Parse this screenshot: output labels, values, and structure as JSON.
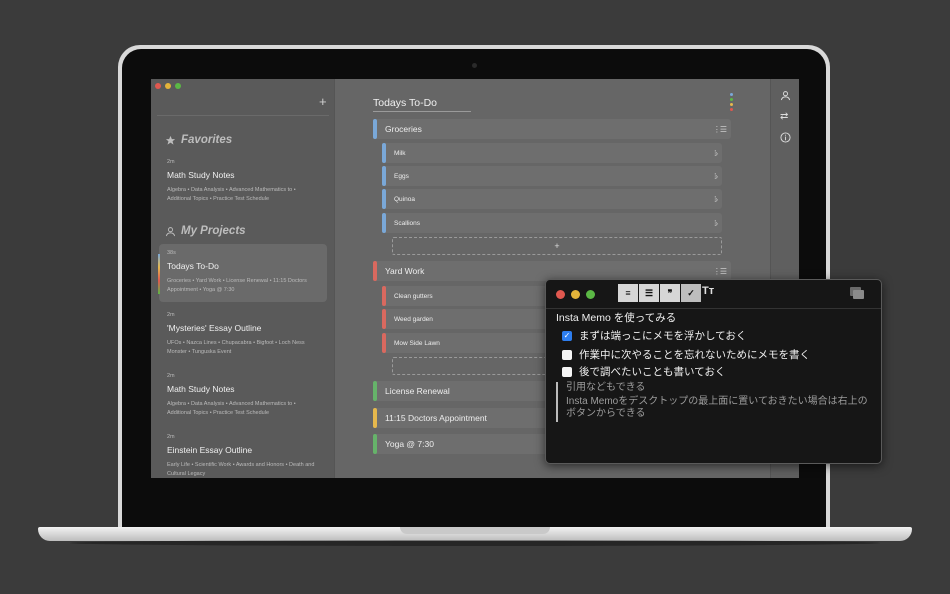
{
  "colors": {
    "red": "#e0584f",
    "yellow": "#e3b33a",
    "green": "#5bb845",
    "blue": "#2d7ef0",
    "groceries": "#7aa8d8",
    "yard": "#d9695f",
    "license": "#66b36a",
    "doctor": "#e6b84d"
  },
  "sidebar": {
    "add_icon": "+",
    "favorites": {
      "icon": "star-icon",
      "title": "Favorites"
    },
    "projects": {
      "icon": "person-icon",
      "title": "My Projects"
    },
    "favorite_notes": [
      {
        "age": "2m",
        "title": "Math Study Notes",
        "summary": "Algebra • Data Analysis • Advanced Mathematics to • Additional Topics • Practice Test Schedule"
      }
    ],
    "project_notes": [
      {
        "age": "38s",
        "title": "Todays To-Do",
        "summary": "Groceries • Yard Work • License Renewal • 11:15 Doctors Appointment • Yoga @ 7:30"
      },
      {
        "age": "2m",
        "title": "'Mysteries' Essay Outline",
        "summary": "UFOs • Nazca Lines • Chupacabra • Bigfoot • Loch Ness Monster • Tunguska Event"
      },
      {
        "age": "2m",
        "title": "Math Study Notes",
        "summary": "Algebra • Data Analysis • Advanced Mathematics to • Additional Topics • Practice Test Schedule"
      },
      {
        "age": "2m",
        "title": "Einstein Essay Outline",
        "summary": "Early Life • Scientific Work • Awards and Honors • Death and Cultural Legacy"
      }
    ]
  },
  "main": {
    "title": "Todays To-Do",
    "groceries": {
      "label": "Groceries",
      "items": [
        "Milk",
        "Eggs",
        "Quinoa",
        "Scallions"
      ]
    },
    "add_label": "+",
    "yard": {
      "label": "Yard Work",
      "items": [
        "Clean gutters",
        "Weed garden",
        "Mow Side Lawn"
      ]
    },
    "others": [
      "License Renewal",
      "11:15 Doctors Appointment",
      "Yoga @ 7:30"
    ]
  },
  "memo": {
    "toolbar": {
      "list1": "≡",
      "list2": "☰",
      "quote": "❞",
      "check": "✓",
      "text_size": "Tт"
    },
    "heading": "Insta Memo を使ってみる",
    "checklist": [
      {
        "text": "まずは端っこにメモを浮かしておく",
        "checked": true
      },
      {
        "text": "作業中に次やることを忘れないためにメモを書く",
        "checked": false
      },
      {
        "text": "後で調べたいことも書いておく",
        "checked": false
      }
    ],
    "quote_lines": [
      "引用などもできる",
      "Insta Memoをデスクトップの最上面に置いておきたい場合は右上のボタンからできる"
    ]
  }
}
